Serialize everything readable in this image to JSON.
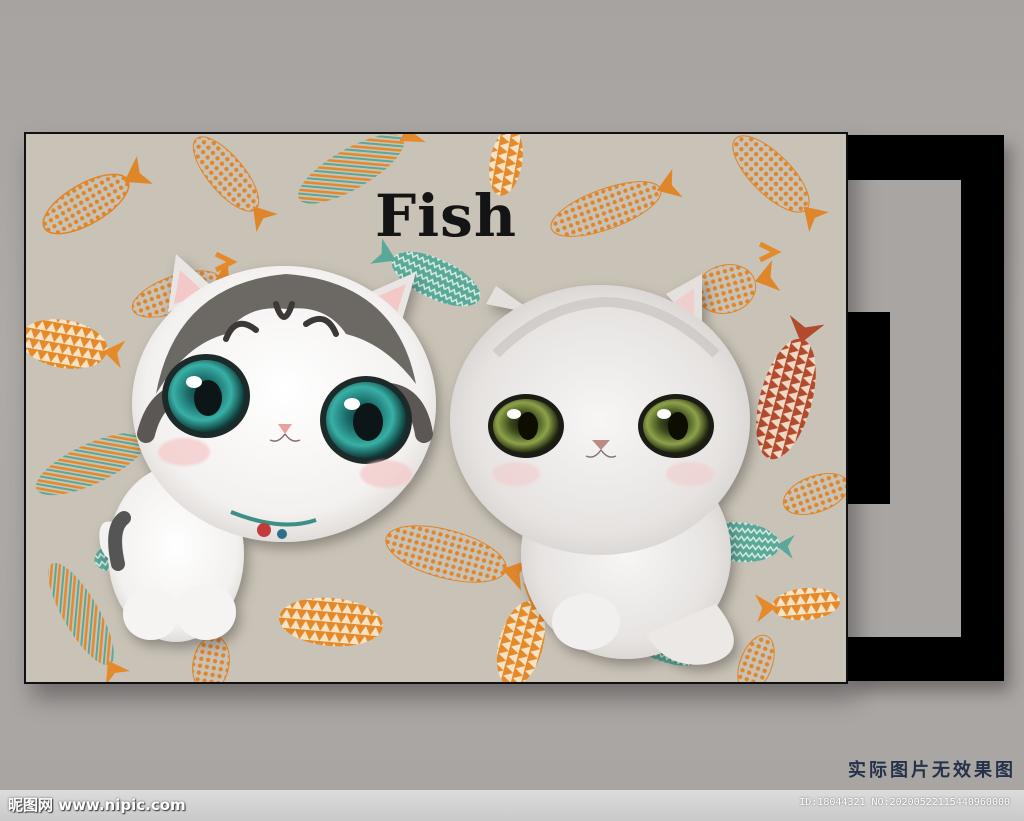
{
  "scene": {
    "title": "Fish",
    "caption": "实际图片无效果图",
    "watermark_left": "昵图网 www.nipic.com",
    "watermark_right": "ID:18044321 NO:20200522115440960000"
  },
  "colors": {
    "wall": "#a9a6a4",
    "canvas_bg": "#c9c2b6",
    "fish_orange": "#e48a2a",
    "fish_teal": "#5aa898",
    "fish_red": "#b24a2e",
    "frame": "#000000",
    "caption": "#26324a"
  },
  "illustration": {
    "subjects": [
      "cat-tabby-white",
      "cat-white-gray"
    ],
    "motif": "fish-pattern"
  }
}
